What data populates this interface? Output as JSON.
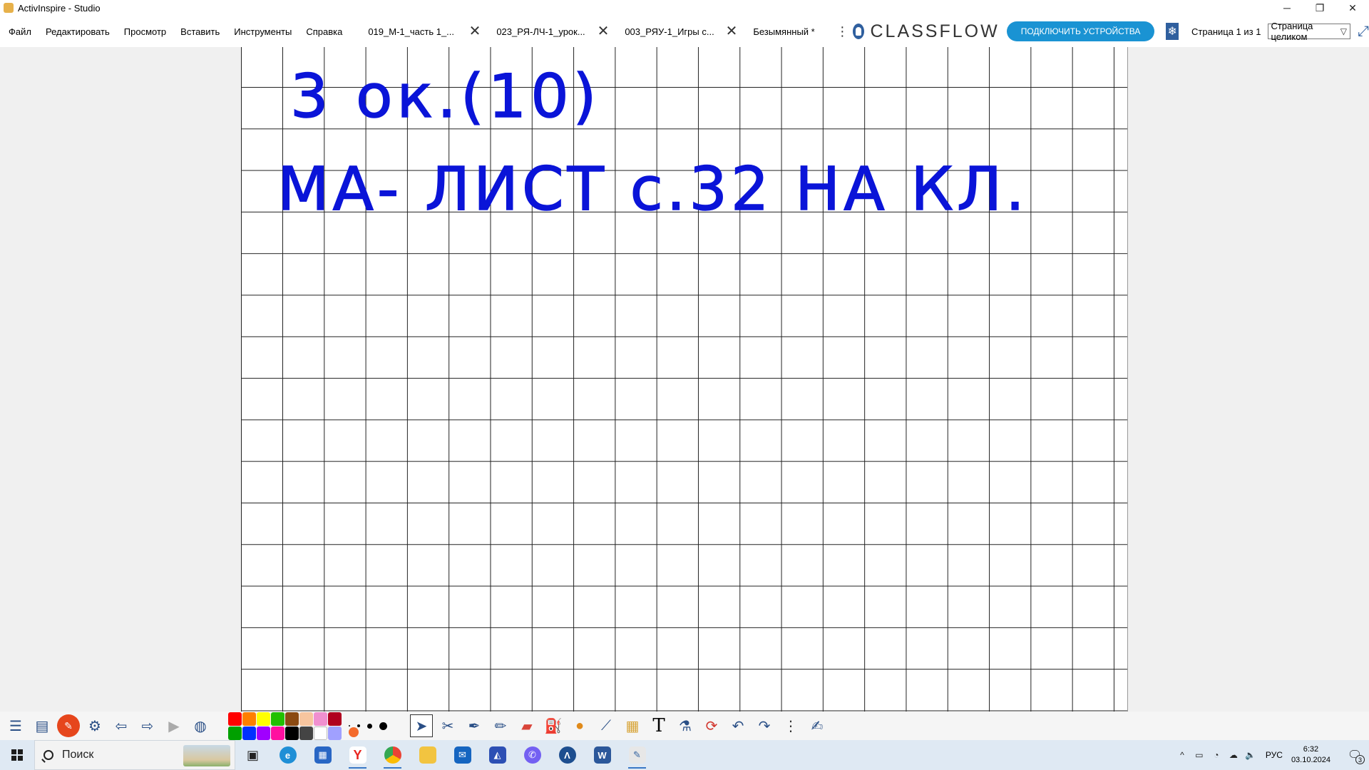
{
  "window": {
    "title": "ActivInspire - Studio",
    "minimize": "─",
    "restore": "❐",
    "close": "✕"
  },
  "menu": [
    "Файл",
    "Редактировать",
    "Просмотр",
    "Вставить",
    "Инструменты",
    "Справка"
  ],
  "tabs": [
    {
      "label": "019_М-1_часть 1_...",
      "close": "✕"
    },
    {
      "label": "023_РЯ-ЛЧ-1_урок...",
      "close": "✕"
    },
    {
      "label": "003_РЯУ-1_Игры с...",
      "close": "✕"
    },
    {
      "label": "Безымянный *"
    }
  ],
  "more": "⋮",
  "classflow": {
    "brand": "CLASSFLOW",
    "connect_button": "ПОДКЛЮЧИТЬ УСТРОЙСТВА"
  },
  "page_counter": "Страница 1 из 1",
  "zoom": {
    "selected": "Страница целиком"
  },
  "board": {
    "line1": "3 ок.(10)",
    "line2": "МА- ЛИСТ с.32 НА КЛ."
  },
  "colors": {
    "accent": "#1a93d3",
    "ink": "#0a14d8",
    "palette": [
      "#ff0000",
      "#ff7f00",
      "#ffff00",
      "#22c000",
      "#8b4a12",
      "#f7c59f",
      "#f090d0",
      "#b00020",
      "#00a000",
      "#0030ff",
      "#a000ff",
      "#ff10a0",
      "#000000",
      "#444444",
      "#ffffff",
      "#a0a0ff"
    ]
  },
  "toolbar_icons": [
    "main-menu-icon",
    "browsers-icon",
    "stop-icon",
    "settings-icon",
    "previous-page-icon",
    "next-page-icon",
    "play-icon",
    "globe-icon"
  ],
  "tools": [
    "select-icon",
    "tools-icon",
    "pen-icon",
    "highlighter-icon",
    "eraser-icon",
    "fill-icon",
    "shape-icon",
    "connector-icon",
    "magic-ink-icon",
    "text-icon",
    "clear-icon",
    "reset-icon",
    "undo-icon",
    "redo-icon",
    "more-icon",
    "desk-icon"
  ],
  "taskbar": {
    "search_placeholder": "Поиск",
    "lang": "РУС",
    "time": "6:32",
    "date": "03.10.2024",
    "notifications": "3"
  }
}
